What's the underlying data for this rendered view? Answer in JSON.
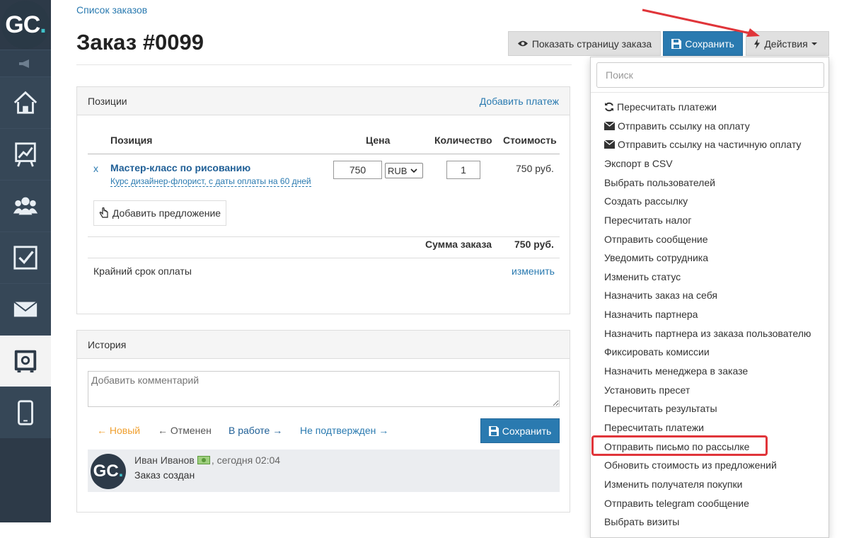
{
  "sidebar": {
    "logo_text": "GC",
    "logo_dot": ".",
    "items": [
      "home-icon",
      "chart-icon",
      "users-icon",
      "tasks-icon",
      "mail-icon",
      "safe-icon",
      "phone-icon"
    ]
  },
  "breadcrumb": "Список заказов",
  "title": "Заказ #0099",
  "header_buttons": {
    "show_page": "Показать страницу заказа",
    "save": "Сохранить",
    "actions": "Действия"
  },
  "positions": {
    "title": "Позиции",
    "add_payment": "Добавить платеж",
    "columns": [
      "Позиция",
      "Цена",
      "Количество",
      "Стоимость"
    ],
    "row": {
      "remove": "x",
      "name": "Мастер-класс по рисованию",
      "subtitle": "Курс дизайнер-флорист, с даты оплаты на 60 дней",
      "price": "750",
      "currency": "RUB",
      "quantity": "1",
      "cost": "750 руб."
    },
    "add_offer": "Добавить предложение",
    "total_label": "Сумма заказа",
    "total_value": "750 руб.",
    "deadline_label": "Крайний срок оплаты",
    "deadline_action": "изменить"
  },
  "history": {
    "title": "История",
    "comment_placeholder": "Добавить комментарий",
    "statuses": {
      "new": "← Новый",
      "cancelled": "← Отменен",
      "in_work": "В работе →",
      "unconfirmed": "Не подтвержден →"
    },
    "save": "Сохранить",
    "entry": {
      "author": "Иван Иванов",
      "time": ", сегодня 02:04",
      "text": "Заказ создан"
    }
  },
  "dropdown": {
    "search_placeholder": "Поиск",
    "items": [
      "Пересчитать платежи",
      "Отправить ссылку на оплату",
      "Отправить ссылку на частичную оплату",
      "Экспорт в CSV",
      "Выбрать пользователей",
      "Создать рассылку",
      "Пересчитать налог",
      "Отправить сообщение",
      "Уведомить сотрудника",
      "Изменить статус",
      "Назначить заказ на себя",
      "Назначить партнера",
      "Назначить партнера из заказа пользователю",
      "Фиксировать комиссии",
      "Назначить менеджера в заказе",
      "Установить пресет",
      "Пересчитать результаты",
      "Пересчитать платежи",
      "Отправить письмо по рассылке",
      "Обновить стоимость из предложений",
      "Изменить получателя покупки",
      "Отправить telegram сообщение",
      "Выбрать визиты"
    ]
  },
  "colors": {
    "accent_blue": "#2a7ab0",
    "status_new": "#f0a030",
    "highlight": "#e0353a",
    "sidebar": "#2d3a48"
  }
}
